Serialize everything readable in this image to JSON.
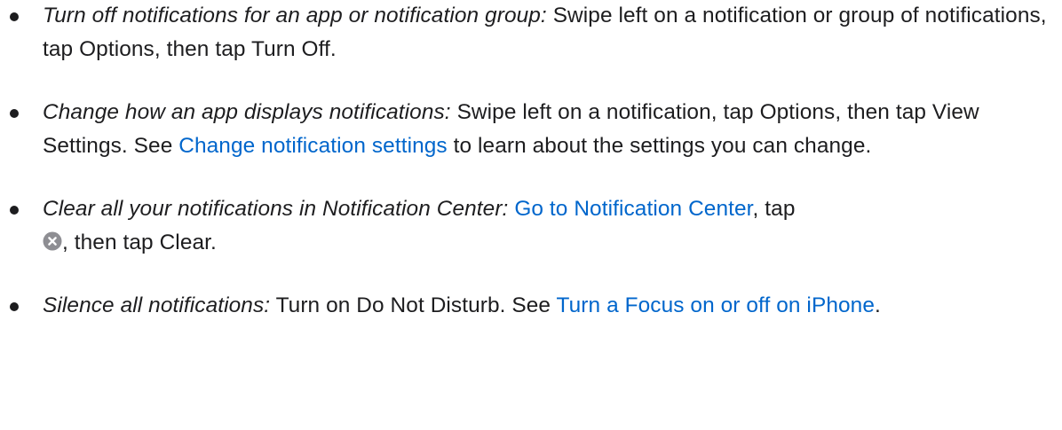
{
  "items": [
    {
      "label": "Turn off notifications for an app or notification group:",
      "text": " Swipe left on a notification or group of notifications, tap Options, then tap Turn Off."
    },
    {
      "label": "Change how an app displays notifications:",
      "text_before": " Swipe left on a notification, tap Options, then tap View Settings. See ",
      "link": "Change notification settings",
      "text_after": " to learn about the settings you can change."
    },
    {
      "label": "Clear all your notifications in Notification Center:",
      "text_before": " ",
      "link": "Go to Notification Center",
      "text_middle": ", tap ",
      "icon": "clear-x-circle-icon",
      "text_after": ", then tap Clear."
    },
    {
      "label": "Silence all notifications:",
      "text_before": " Turn on Do Not Disturb. See ",
      "link": "Turn a Focus on or off on iPhone",
      "text_after": "."
    }
  ],
  "colors": {
    "text": "#1d1d1f",
    "link": "#0066cc",
    "icon_fill": "#8e8e93"
  }
}
